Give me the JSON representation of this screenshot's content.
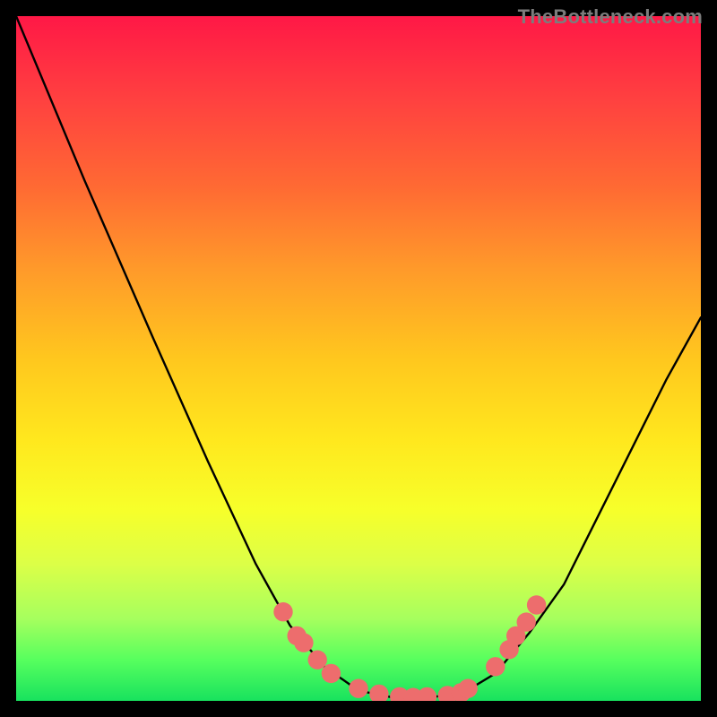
{
  "watermark": "TheBottleneck.com",
  "chart_data": {
    "type": "line",
    "title": "",
    "xlabel": "",
    "ylabel": "",
    "xlim": [
      0,
      1
    ],
    "ylim": [
      0,
      1
    ],
    "note": "Axes are unlabelled; x and y are normalized 0–1 within the colored plot area. y=1 is top (red), y=0 is bottom (green). Curve is a V / valley shape with flat bottom near x≈0.50–0.66.",
    "series": [
      {
        "name": "curve",
        "color": "#000000",
        "points": [
          {
            "x": 0.0,
            "y": 1.0
          },
          {
            "x": 0.1,
            "y": 0.76
          },
          {
            "x": 0.2,
            "y": 0.53
          },
          {
            "x": 0.28,
            "y": 0.35
          },
          {
            "x": 0.35,
            "y": 0.2
          },
          {
            "x": 0.4,
            "y": 0.11
          },
          {
            "x": 0.45,
            "y": 0.05
          },
          {
            "x": 0.5,
            "y": 0.015
          },
          {
            "x": 0.55,
            "y": 0.005
          },
          {
            "x": 0.6,
            "y": 0.005
          },
          {
            "x": 0.65,
            "y": 0.01
          },
          {
            "x": 0.7,
            "y": 0.04
          },
          {
            "x": 0.75,
            "y": 0.1
          },
          {
            "x": 0.8,
            "y": 0.17
          },
          {
            "x": 0.85,
            "y": 0.27
          },
          {
            "x": 0.9,
            "y": 0.37
          },
          {
            "x": 0.95,
            "y": 0.47
          },
          {
            "x": 1.0,
            "y": 0.56
          }
        ]
      }
    ],
    "markers": {
      "name": "dots",
      "color": "#ed6d6d",
      "radius": 0.014,
      "points": [
        {
          "x": 0.39,
          "y": 0.13
        },
        {
          "x": 0.41,
          "y": 0.095
        },
        {
          "x": 0.42,
          "y": 0.085
        },
        {
          "x": 0.44,
          "y": 0.06
        },
        {
          "x": 0.46,
          "y": 0.04
        },
        {
          "x": 0.5,
          "y": 0.018
        },
        {
          "x": 0.53,
          "y": 0.01
        },
        {
          "x": 0.56,
          "y": 0.006
        },
        {
          "x": 0.58,
          "y": 0.005
        },
        {
          "x": 0.6,
          "y": 0.006
        },
        {
          "x": 0.63,
          "y": 0.008
        },
        {
          "x": 0.65,
          "y": 0.012
        },
        {
          "x": 0.66,
          "y": 0.018
        },
        {
          "x": 0.7,
          "y": 0.05
        },
        {
          "x": 0.72,
          "y": 0.075
        },
        {
          "x": 0.73,
          "y": 0.095
        },
        {
          "x": 0.745,
          "y": 0.115
        },
        {
          "x": 0.76,
          "y": 0.14
        }
      ]
    },
    "gradient_stops": [
      {
        "pos": 0.0,
        "color": "#ff1846"
      },
      {
        "pos": 0.12,
        "color": "#ff4040"
      },
      {
        "pos": 0.25,
        "color": "#ff6a33"
      },
      {
        "pos": 0.37,
        "color": "#ff9a2a"
      },
      {
        "pos": 0.5,
        "color": "#ffc71e"
      },
      {
        "pos": 0.62,
        "color": "#ffe81e"
      },
      {
        "pos": 0.72,
        "color": "#f7ff2a"
      },
      {
        "pos": 0.8,
        "color": "#dcff47"
      },
      {
        "pos": 0.88,
        "color": "#a6ff5e"
      },
      {
        "pos": 0.94,
        "color": "#57ff5e"
      },
      {
        "pos": 1.0,
        "color": "#18e25e"
      }
    ]
  }
}
